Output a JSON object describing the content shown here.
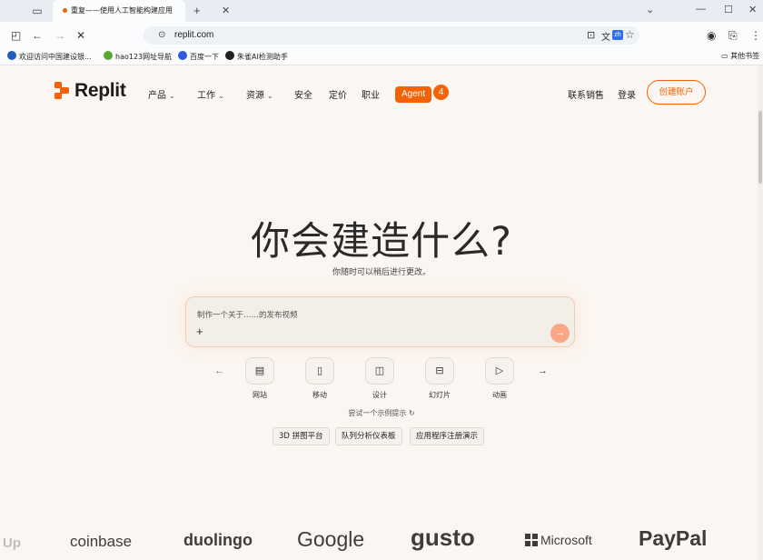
{
  "browser": {
    "tab_title": "重复——使用人工智能构建应用",
    "url": "replit.com",
    "translate_badge": "zh",
    "bookmarks": [
      {
        "label": "欢迎访问中国建设银...",
        "color": "#1f5fbf"
      },
      {
        "label": "hao123网址导航",
        "color": "#5aa832"
      },
      {
        "label": "百度一下",
        "color": "#2f5be0"
      },
      {
        "label": "朱雀AI检测助手",
        "color": "#222222"
      }
    ],
    "other_bookmarks": "其他书签"
  },
  "site": {
    "logo_text": "Replit",
    "accent": "#f26207",
    "nav": {
      "products": "产品",
      "work": "工作",
      "resources": "资源",
      "security": "安全",
      "pricing": "定价",
      "careers": "职业",
      "agent_label": "Agent",
      "agent_count": "4",
      "contact_sales": "联系销售",
      "login": "登录",
      "create_account": "创建账户"
    },
    "hero": {
      "title": "你会建造什么?",
      "subtitle": "你随时可以稍后进行更改。"
    },
    "prompt": {
      "placeholder": "制作一个关于……的发布视频"
    },
    "categories": [
      {
        "label": "网站",
        "icon": "browser-window-icon"
      },
      {
        "label": "移动",
        "icon": "mobile-phone-icon"
      },
      {
        "label": "设计",
        "icon": "design-canvas-icon"
      },
      {
        "label": "幻灯片",
        "icon": "slides-stack-icon"
      },
      {
        "label": "动画",
        "icon": "animation-play-icon"
      }
    ],
    "try_example": "尝试一个示例提示",
    "examples": [
      "3D 拼图平台",
      "队列分析仪表板",
      "应用程序注册演示"
    ],
    "brands": [
      "Up",
      "coinbase",
      "duolingo",
      "Google",
      "gusto",
      "Microsoft",
      "PayPal"
    ]
  }
}
